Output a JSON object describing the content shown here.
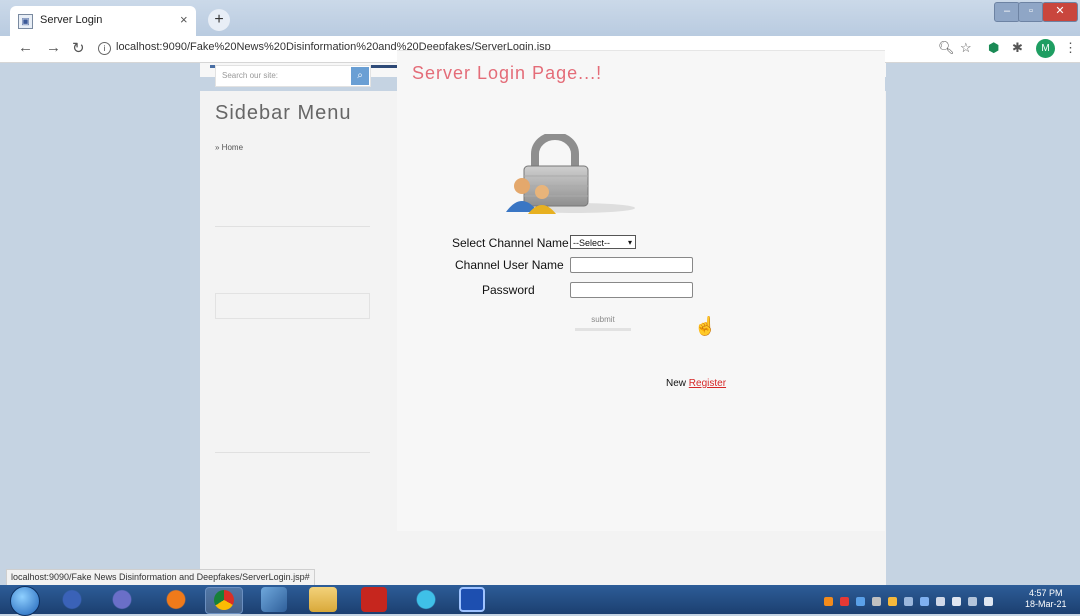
{
  "browser": {
    "tab_title": "Server Login",
    "tab_close": "×",
    "new_tab": "+",
    "url": "localhost:9090/Fake%20News%20Disinformation%20and%20Deepfakes/ServerLogin.jsp",
    "profile_initial": "M",
    "status_url": "localhost:9090/Fake News Disinformation and Deepfakes/ServerLogin.jsp#"
  },
  "sidebar": {
    "search_placeholder": "Search our site:",
    "title": "Sidebar Menu",
    "home_link": "» Home"
  },
  "main": {
    "title": "Server Login Page...!",
    "labels": {
      "channel_name": "Select Channel Name",
      "channel_user": "Channel User Name",
      "password": "Password"
    },
    "select_value": "--Select--",
    "submit_label": "submit",
    "register_prefix": "New",
    "register_link": "Register"
  },
  "taskbar": {
    "time": "4:57 PM",
    "date": "18-Mar-21"
  },
  "colors": {
    "page_title": "#e46c78",
    "register_link": "#d62727",
    "search_button": "#6a9fd4"
  }
}
